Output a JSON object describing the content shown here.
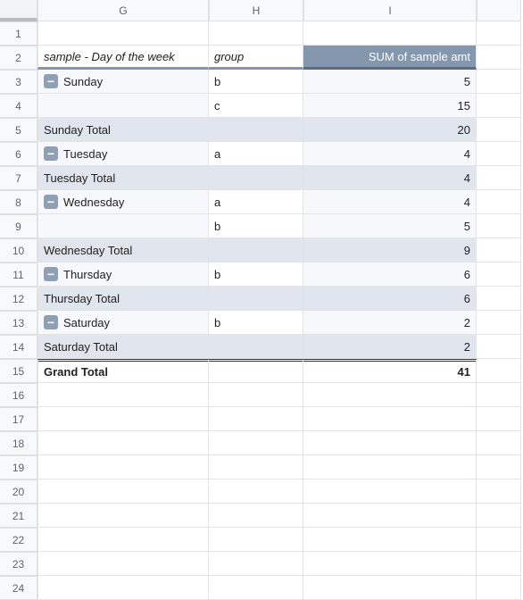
{
  "columns": {
    "corner": "",
    "g": "G",
    "h": "H",
    "i": "I",
    "extra": ""
  },
  "row_numbers": [
    "1",
    "2",
    "3",
    "4",
    "5",
    "6",
    "7",
    "8",
    "9",
    "10",
    "11",
    "12",
    "13",
    "14",
    "15",
    "16",
    "17",
    "18",
    "19",
    "20",
    "21",
    "22",
    "23",
    "24"
  ],
  "pivot": {
    "title_row_col": "sample - Day of the week",
    "title_group": "group",
    "title_value": "SUM of sample amt",
    "collapse_glyph": "−",
    "rows": [
      {
        "type": "detail_first",
        "label": "Sunday",
        "group": "b",
        "value": "5"
      },
      {
        "type": "detail",
        "label": "",
        "group": "c",
        "value": "15"
      },
      {
        "type": "subtotal",
        "label": "Sunday Total",
        "group": "",
        "value": "20"
      },
      {
        "type": "detail_first",
        "label": "Tuesday",
        "group": "a",
        "value": "4"
      },
      {
        "type": "subtotal",
        "label": "Tuesday Total",
        "group": "",
        "value": "4"
      },
      {
        "type": "detail_first",
        "label": "Wednesday",
        "group": "a",
        "value": "4"
      },
      {
        "type": "detail",
        "label": "",
        "group": "b",
        "value": "5"
      },
      {
        "type": "subtotal",
        "label": "Wednesday Total",
        "group": "",
        "value": "9"
      },
      {
        "type": "detail_first",
        "label": "Thursday",
        "group": "b",
        "value": "6"
      },
      {
        "type": "subtotal",
        "label": "Thursday Total",
        "group": "",
        "value": "6"
      },
      {
        "type": "detail_first",
        "label": "Saturday",
        "group": "b",
        "value": "2"
      },
      {
        "type": "subtotal",
        "label": "Saturday Total",
        "group": "",
        "value": "2"
      },
      {
        "type": "grand",
        "label": "Grand Total",
        "group": "",
        "value": "41"
      }
    ]
  },
  "chart_data": {
    "type": "table",
    "title": "Pivot: SUM of sample amt by Day of the week / group",
    "columns": [
      "Day of the week",
      "group",
      "SUM of sample amt"
    ],
    "rows": [
      [
        "Sunday",
        "b",
        5
      ],
      [
        "Sunday",
        "c",
        15
      ],
      [
        "Sunday Total",
        "",
        20
      ],
      [
        "Tuesday",
        "a",
        4
      ],
      [
        "Tuesday Total",
        "",
        4
      ],
      [
        "Wednesday",
        "a",
        4
      ],
      [
        "Wednesday",
        "b",
        5
      ],
      [
        "Wednesday Total",
        "",
        9
      ],
      [
        "Thursday",
        "b",
        6
      ],
      [
        "Thursday Total",
        "",
        6
      ],
      [
        "Saturday",
        "b",
        2
      ],
      [
        "Saturday Total",
        "",
        2
      ],
      [
        "Grand Total",
        "",
        41
      ]
    ]
  }
}
